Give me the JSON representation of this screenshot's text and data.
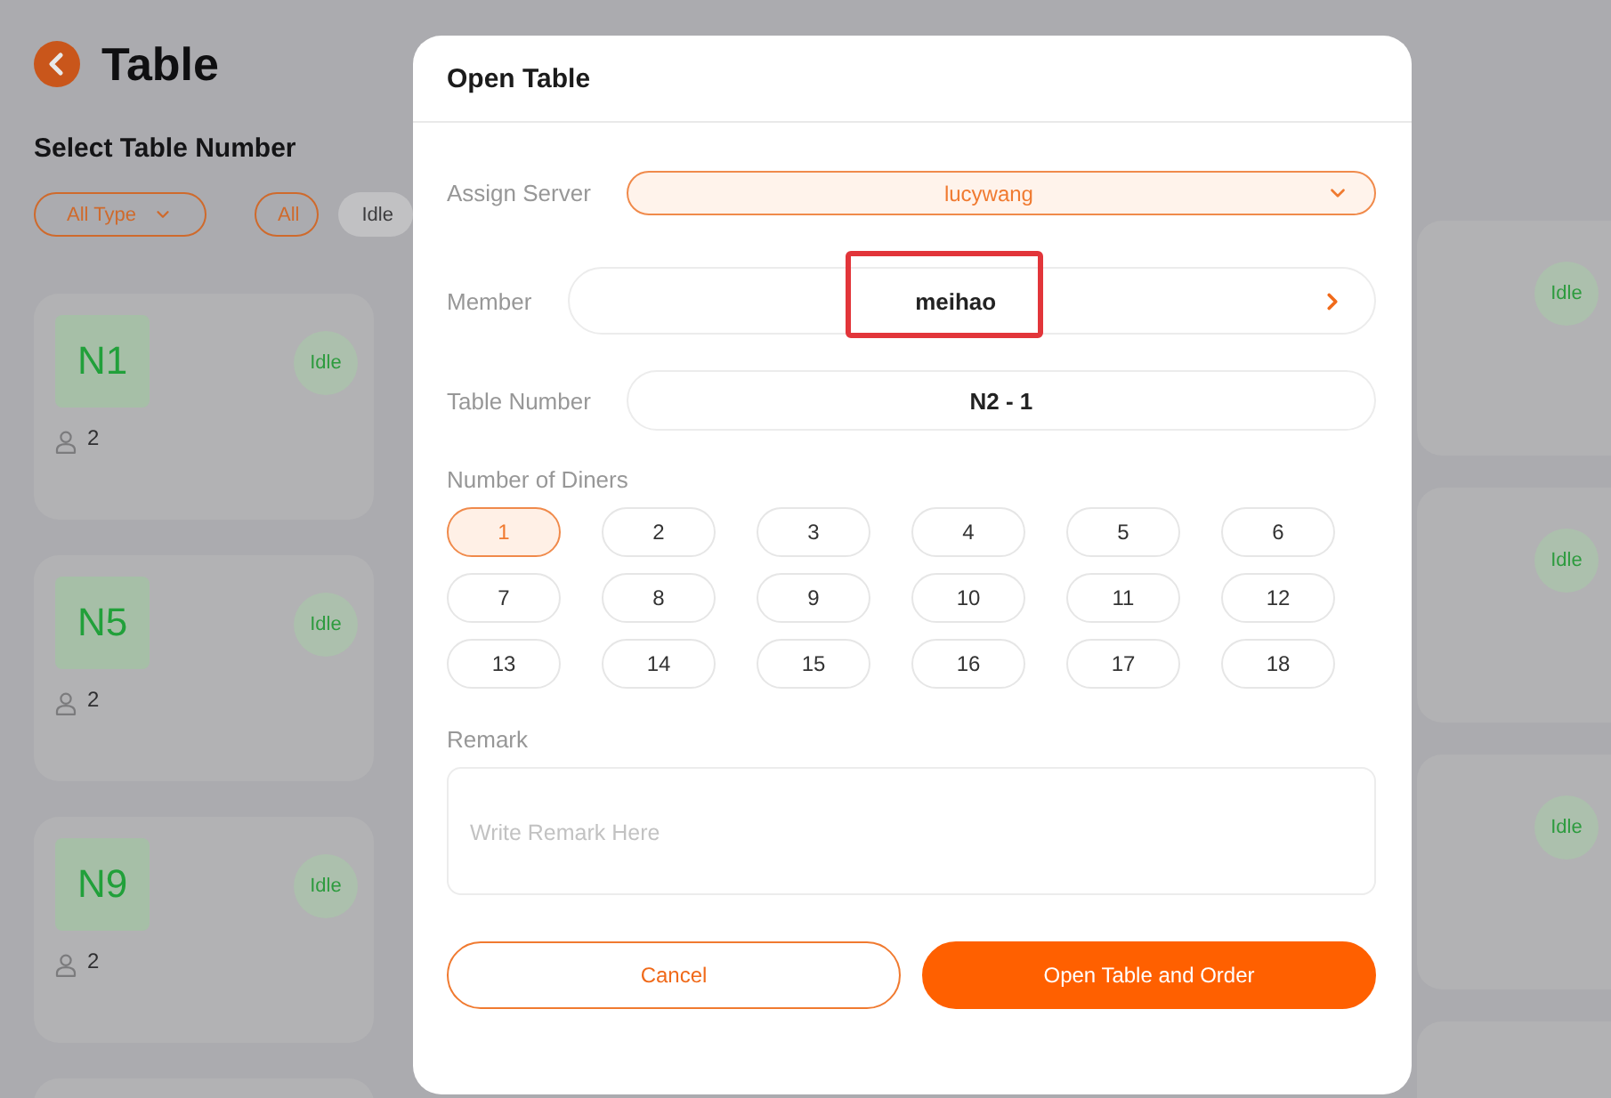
{
  "page": {
    "title": "Table",
    "section_title": "Select Table Number",
    "filters": {
      "type_dropdown": "All Type",
      "status_chips": [
        {
          "label": "All",
          "selected": true
        },
        {
          "label": "Idle",
          "selected": false
        }
      ]
    },
    "tables_left": [
      {
        "number": "N1",
        "status": "Idle",
        "guests": "2"
      },
      {
        "number": "N5",
        "status": "Idle",
        "guests": "2"
      },
      {
        "number": "N9",
        "status": "Idle",
        "guests": "2"
      }
    ],
    "tables_right": [
      {
        "status": "Idle"
      },
      {
        "status": "Idle"
      },
      {
        "status": "Idle"
      }
    ]
  },
  "dialog": {
    "title": "Open Table",
    "assign_server": {
      "label": "Assign Server",
      "value": "lucywang"
    },
    "member": {
      "label": "Member",
      "value": "meihao",
      "highlighted": true
    },
    "table_number": {
      "label": "Table Number",
      "value": "N2 - 1"
    },
    "diners": {
      "label": "Number of Diners",
      "options": [
        {
          "label": "1",
          "selected": true
        },
        {
          "label": "2",
          "selected": false
        },
        {
          "label": "3",
          "selected": false
        },
        {
          "label": "4",
          "selected": false
        },
        {
          "label": "5",
          "selected": false
        },
        {
          "label": "6",
          "selected": false
        },
        {
          "label": "7",
          "selected": false
        },
        {
          "label": "8",
          "selected": false
        },
        {
          "label": "9",
          "selected": false
        },
        {
          "label": "10",
          "selected": false
        },
        {
          "label": "11",
          "selected": false
        },
        {
          "label": "12",
          "selected": false
        },
        {
          "label": "13",
          "selected": false
        },
        {
          "label": "14",
          "selected": false
        },
        {
          "label": "15",
          "selected": false
        },
        {
          "label": "16",
          "selected": false
        },
        {
          "label": "17",
          "selected": false
        },
        {
          "label": "18",
          "selected": false
        }
      ]
    },
    "remark": {
      "label": "Remark",
      "placeholder": "Write Remark Here"
    },
    "buttons": [
      {
        "label": "Cancel",
        "kind": "secondary"
      },
      {
        "label": "Open Table and Order",
        "kind": "primary"
      }
    ]
  }
}
